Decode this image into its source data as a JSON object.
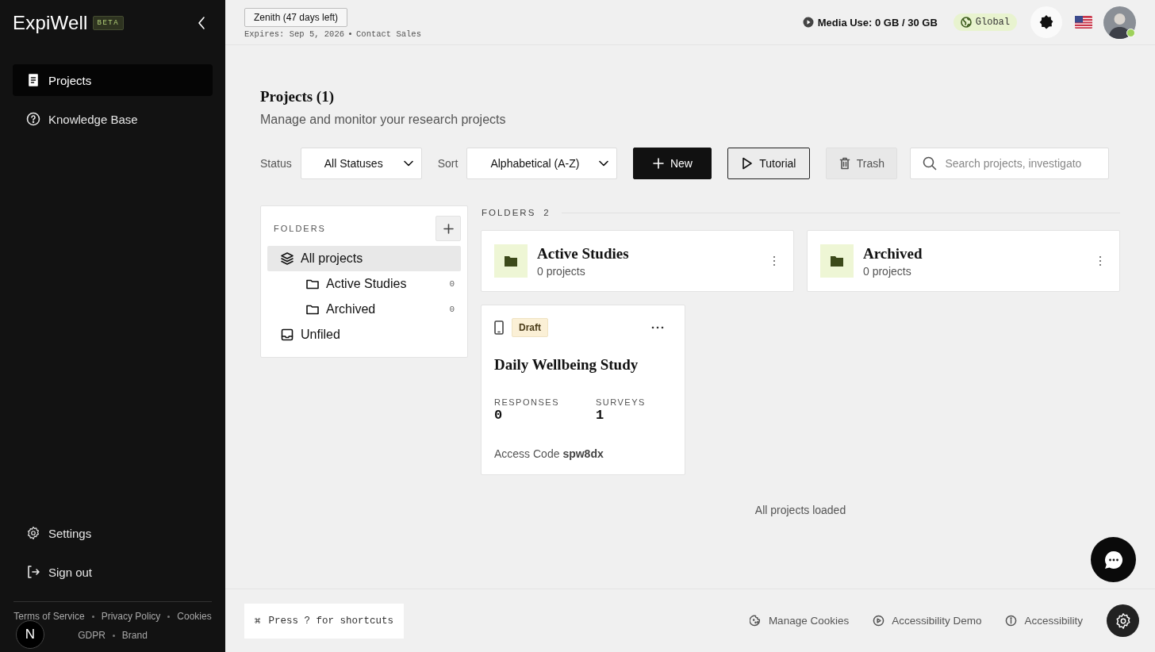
{
  "sidebar": {
    "logo": "ExpiWell",
    "badge": "BETA",
    "nav": [
      {
        "kind": "projects",
        "label": "Projects",
        "selected": true
      },
      {
        "kind": "help",
        "label": "Knowledge Base",
        "selected": false
      }
    ],
    "bottom_nav": [
      {
        "kind": "settings",
        "label": "Settings"
      },
      {
        "kind": "signout",
        "label": "Sign out"
      }
    ],
    "footer_links": [
      [
        "Terms of Service",
        "Privacy Policy",
        "Cookies"
      ],
      [
        "GDPR",
        "Brand"
      ]
    ]
  },
  "dev_badge": "N",
  "topbar": {
    "plan": "Zenith (47 days left)",
    "expires": "Expires: Sep 5, 2026",
    "contact": "Contact Sales",
    "media": "Media Use: 0 GB / 30 GB",
    "region": "Global"
  },
  "page": {
    "title": "Projects (1)",
    "subtitle": "Manage and monitor your research projects",
    "filters": [
      {
        "label": "Status",
        "value": "All Statuses"
      },
      {
        "label": "Sort",
        "value": "Alphabetical (A-Z)"
      }
    ],
    "buttons": [
      {
        "kind": "primary",
        "label": "New"
      },
      {
        "kind": "outline",
        "label": "Tutorial"
      },
      {
        "kind": "muted",
        "label": "Trash"
      }
    ],
    "search": {
      "placeholder": "Search projects, investigato"
    }
  },
  "folder_panel": {
    "title": "FOLDERS",
    "items": [
      {
        "kind": "all",
        "label": "All projects",
        "selected": true,
        "children": [
          {
            "label": "Active Studies",
            "count": "0",
            "selected": false
          },
          {
            "label": "Archived",
            "count": "0",
            "selected": false
          }
        ]
      },
      {
        "kind": "unfiled",
        "label": "Unfiled",
        "selected": false
      }
    ]
  },
  "folders_section": {
    "title": "FOLDERS",
    "count": "2",
    "folders": [
      {
        "name": "Active Studies",
        "meta": "0 projects"
      },
      {
        "name": "Archived",
        "meta": "0 projects"
      }
    ]
  },
  "projects": [
    {
      "status": "Draft",
      "name": "Daily Wellbeing Study",
      "stats": [
        {
          "label": "RESPONSES",
          "value": "0"
        },
        {
          "label": "SURVEYS",
          "value": "1"
        }
      ],
      "access_label": "Access Code",
      "access_code": "spw8dx"
    }
  ],
  "load_status": "All projects loaded",
  "footer": {
    "shortcut_key": "⌘",
    "shortcut_text": "Press ? for shortcuts",
    "links": [
      {
        "kind": "cookies",
        "label": "Manage Cookies"
      },
      {
        "kind": "demo",
        "label": "Accessibility Demo"
      },
      {
        "kind": "info",
        "label": "Accessibility"
      }
    ]
  }
}
